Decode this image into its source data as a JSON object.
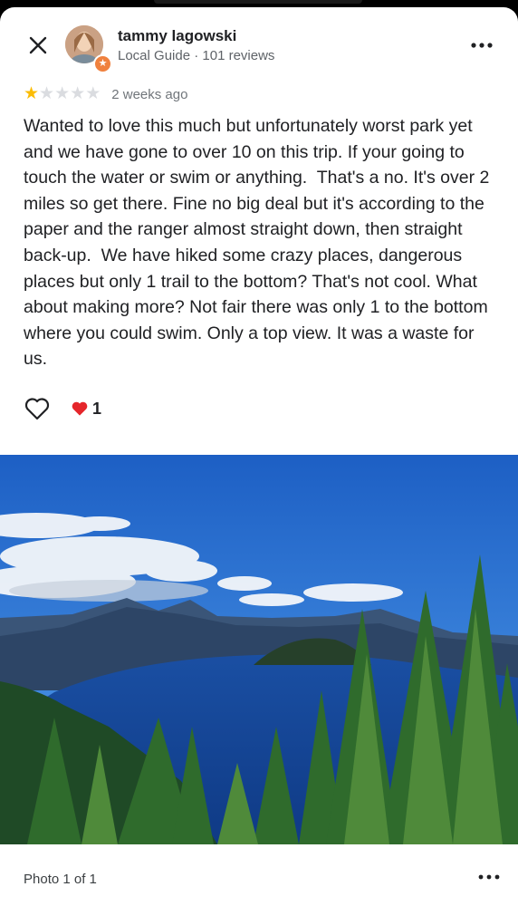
{
  "reviewer": {
    "name": "tammy lagowski",
    "meta": "Local Guide · 101 reviews"
  },
  "review": {
    "rating": 1,
    "max_rating": 5,
    "time_ago": "2 weeks ago",
    "text": "Wanted to love this much but unfortunately worst park yet and we have gone to over 10 on this trip. If your going to touch the water or swim or anything.  That's a no. It's over 2 miles so get there. Fine no big deal but it's according to the paper and the ranger almost straight down, then straight back-up.  We have hiked some crazy places, dangerous places but only 1 trail to the bottom? That's not cool. What about making more? Not fair there was only 1 to the bottom where you could swim. Only a top view. It was a waste for us."
  },
  "reactions": {
    "heart_count": "1"
  },
  "photo": {
    "counter": "Photo 1 of 1"
  },
  "colors": {
    "star_on": "#fbbc04",
    "star_off": "#dadce0",
    "badge": "#f0813e",
    "heart": "#e5262b"
  },
  "icons": [
    "close-icon",
    "more-icon",
    "star-icon",
    "heart-outline-icon",
    "heart-filled-icon",
    "local-guide-badge-icon"
  ]
}
